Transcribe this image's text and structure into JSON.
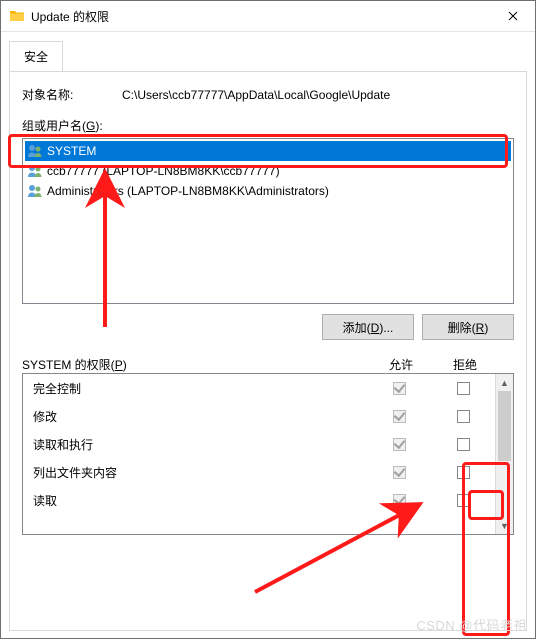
{
  "titlebar": {
    "title": "Update 的权限"
  },
  "tab": {
    "label": "安全"
  },
  "object": {
    "label": "对象名称:",
    "value": "C:\\Users\\ccb77777\\AppData\\Local\\Google\\Update"
  },
  "groups": {
    "label": "组或用户名(G):",
    "items": [
      {
        "name": "SYSTEM",
        "selected": true
      },
      {
        "name": "ccb77777 (LAPTOP-LN8BM8KK\\ccb77777)",
        "selected": false
      },
      {
        "name": "Administrators (LAPTOP-LN8BM8KK\\Administrators)",
        "selected": false
      }
    ]
  },
  "buttons": {
    "add": "添加(D)...",
    "remove": "删除(R)"
  },
  "perm_header": {
    "label": "SYSTEM 的权限(P)",
    "allow": "允许",
    "deny": "拒绝"
  },
  "perms": [
    {
      "name": "完全控制",
      "allow_checked": true
    },
    {
      "name": "修改",
      "allow_checked": true
    },
    {
      "name": "读取和执行",
      "allow_checked": true
    },
    {
      "name": "列出文件夹内容",
      "allow_checked": true
    },
    {
      "name": "读取",
      "allow_checked": true
    }
  ],
  "watermark": "CSDN @代码老祖"
}
